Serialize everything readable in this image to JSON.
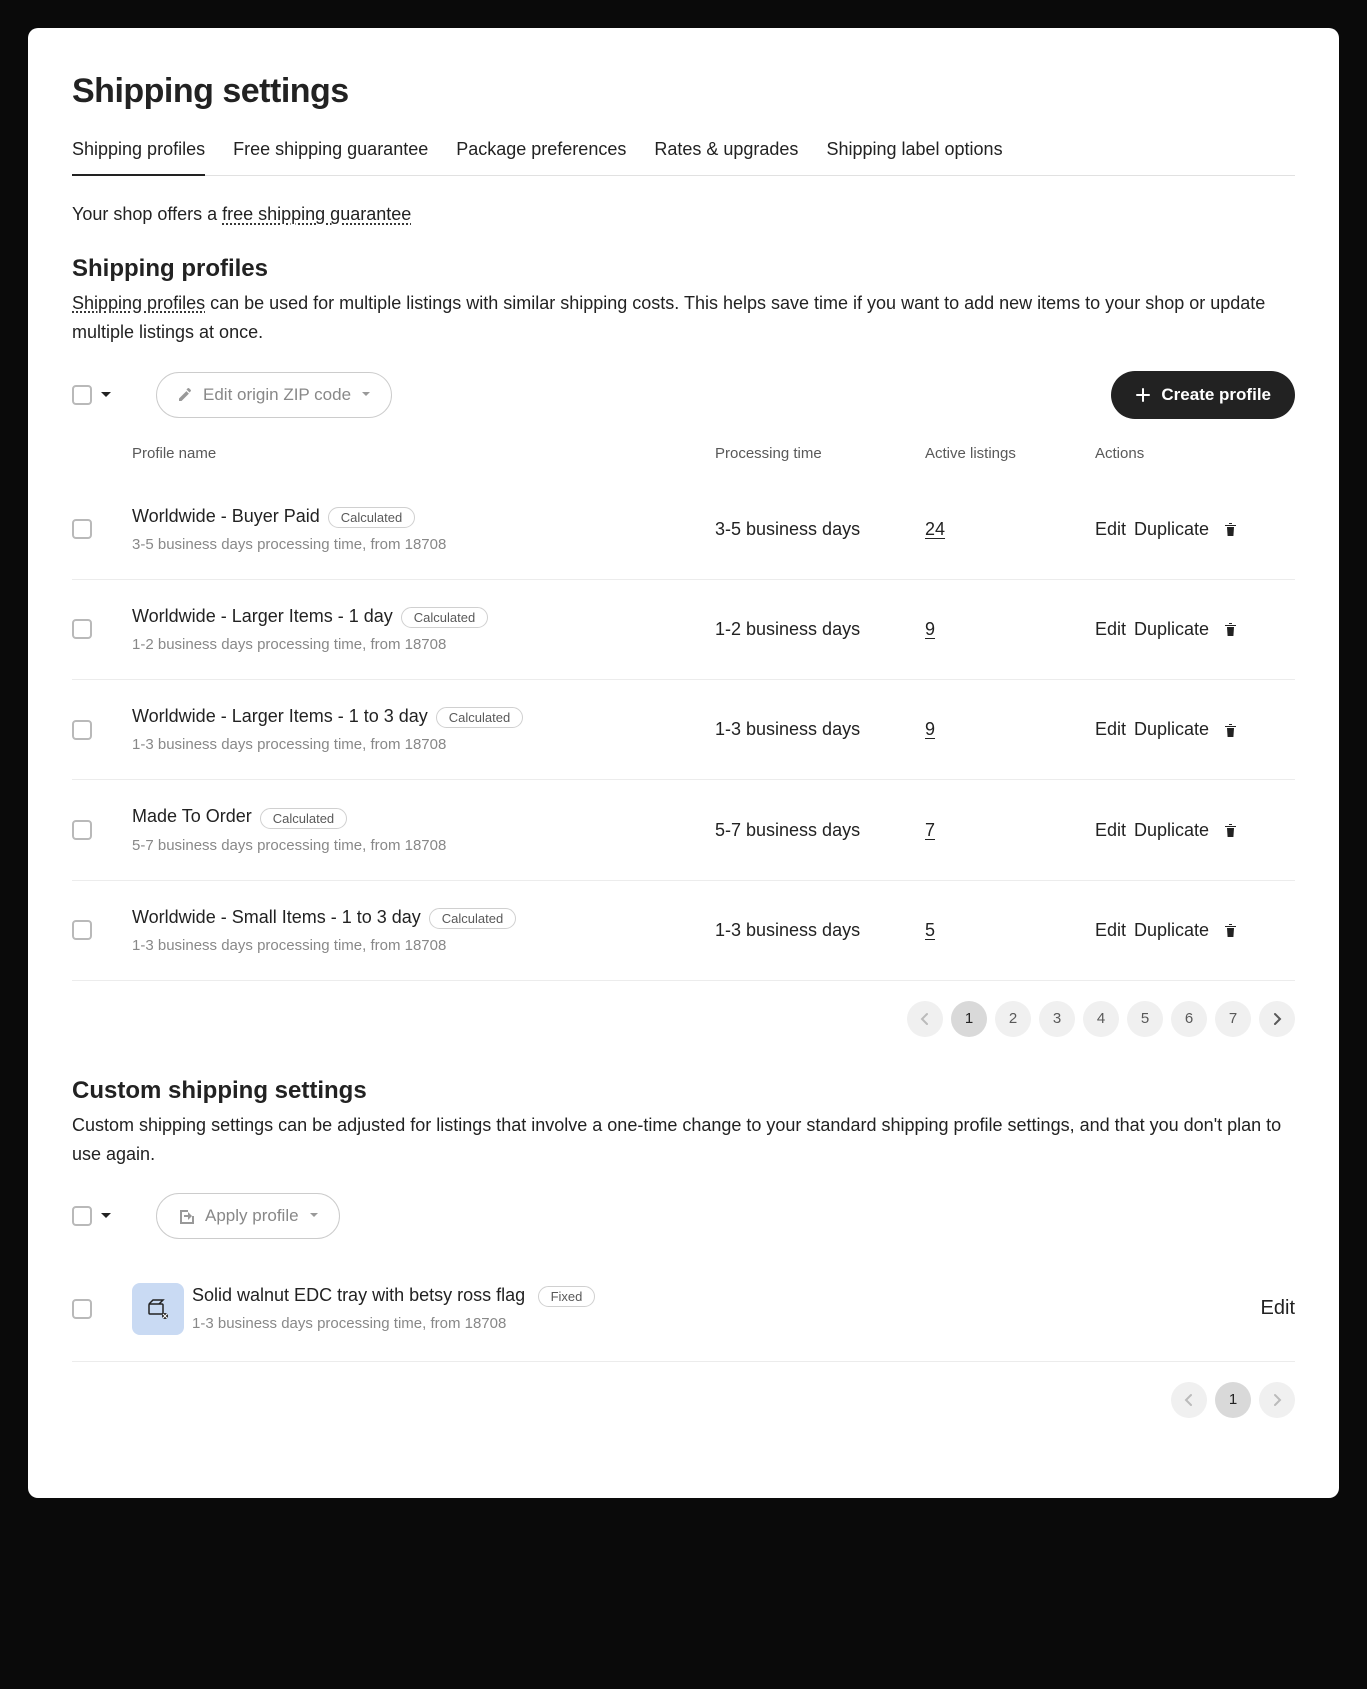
{
  "page_title": "Shipping settings",
  "tabs": [
    "Shipping profiles",
    "Free shipping guarantee",
    "Package preferences",
    "Rates & upgrades",
    "Shipping label options"
  ],
  "active_tab_index": 0,
  "guarantee_prefix": "Your shop offers a ",
  "guarantee_link": "free shipping guarantee",
  "profiles": {
    "title": "Shipping profiles",
    "desc_link": "Shipping profiles",
    "desc_rest": " can be used for multiple listings with similar shipping costs. This helps save time if you want to add new items to your shop or update multiple listings at once.",
    "edit_zip_label": "Edit origin ZIP code",
    "create_label": "Create profile",
    "columns": {
      "name": "Profile name",
      "processing": "Processing time",
      "listings": "Active listings",
      "actions": "Actions"
    },
    "rows": [
      {
        "name": "Worldwide - Buyer Paid",
        "badge": "Calculated",
        "sub": "3-5 business days processing time, from 18708",
        "processing": "3-5 business days",
        "listings": "24"
      },
      {
        "name": "Worldwide - Larger Items - 1 day",
        "badge": "Calculated",
        "sub": "1-2 business days processing time, from 18708",
        "processing": "1-2 business days",
        "listings": "9"
      },
      {
        "name": "Worldwide - Larger Items - 1 to 3 day",
        "badge": "Calculated",
        "sub": "1-3 business days processing time, from 18708",
        "processing": "1-3 business days",
        "listings": "9"
      },
      {
        "name": "Made To Order",
        "badge": "Calculated",
        "sub": "5-7 business days processing time, from 18708",
        "processing": "5-7 business days",
        "listings": "7"
      },
      {
        "name": "Worldwide - Small Items - 1 to 3 day",
        "badge": "Calculated",
        "sub": "1-3 business days processing time, from 18708",
        "processing": "1-3 business days",
        "listings": "5"
      }
    ],
    "edit_label": "Edit",
    "duplicate_label": "Duplicate",
    "pages": [
      "1",
      "2",
      "3",
      "4",
      "5",
      "6",
      "7"
    ],
    "active_page_index": 0
  },
  "custom": {
    "title": "Custom shipping settings",
    "desc": "Custom shipping settings can be adjusted for listings that involve a one-time change to your standard shipping profile settings, and that you don't plan to use again.",
    "apply_label": "Apply profile",
    "rows": [
      {
        "name": "Solid walnut EDC tray with betsy ross flag",
        "badge": "Fixed",
        "sub": "1-3 business days processing time, from 18708"
      }
    ],
    "edit_label": "Edit",
    "pages": [
      "1"
    ],
    "active_page_index": 0
  }
}
